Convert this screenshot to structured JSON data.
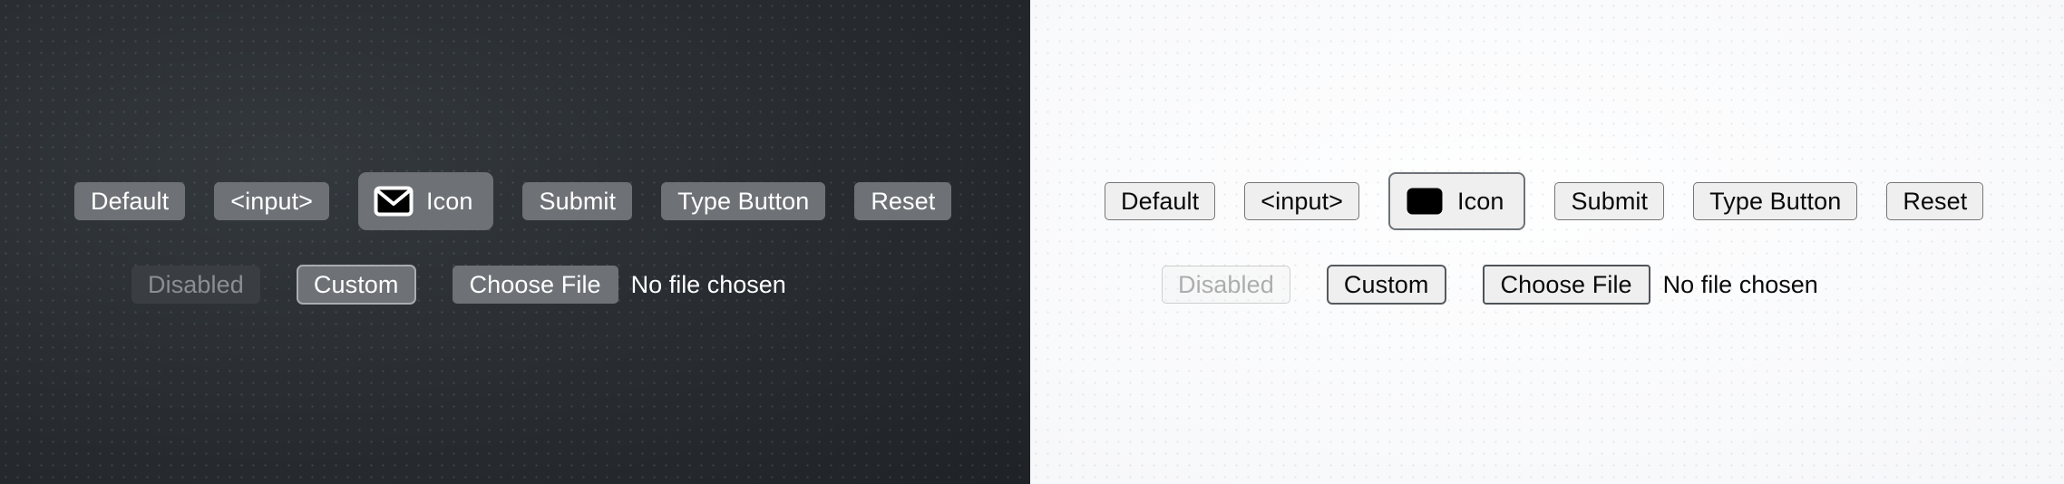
{
  "theme": {
    "dark_background": "#272b2f",
    "light_background": "#f8f9fb",
    "dark_button_fill": "#6e7176",
    "dark_button_text": "#ffffff",
    "dark_disabled_fill": "#3a3e42",
    "dark_disabled_text": "#8b8f94",
    "light_button_fill": "#efefef",
    "light_button_border": "#767676",
    "light_button_text": "#0a0a0a",
    "icon_glyph_color": "#ffffff",
    "icon_glyph_fill": "#000000"
  },
  "panels": [
    {
      "name": "dark",
      "row_primary": [
        {
          "key": "default",
          "label": "Default",
          "icon": null
        },
        {
          "key": "input",
          "label": "<input>",
          "icon": null
        },
        {
          "key": "icon",
          "label": "Icon",
          "icon": "envelope-icon"
        },
        {
          "key": "submit",
          "label": "Submit",
          "icon": null
        },
        {
          "key": "type-button",
          "label": "Type Button",
          "icon": null
        },
        {
          "key": "reset",
          "label": "Reset",
          "icon": null
        }
      ],
      "row_secondary": {
        "disabled_label": "Disabled",
        "custom_label": "Custom",
        "file_button_label": "Choose File",
        "file_status": "No file chosen"
      }
    },
    {
      "name": "light",
      "row_primary": [
        {
          "key": "default",
          "label": "Default",
          "icon": null
        },
        {
          "key": "input",
          "label": "<input>",
          "icon": null
        },
        {
          "key": "icon",
          "label": "Icon",
          "icon": "envelope-icon"
        },
        {
          "key": "submit",
          "label": "Submit",
          "icon": null
        },
        {
          "key": "type-button",
          "label": "Type Button",
          "icon": null
        },
        {
          "key": "reset",
          "label": "Reset",
          "icon": null
        }
      ],
      "row_secondary": {
        "disabled_label": "Disabled",
        "custom_label": "Custom",
        "file_button_label": "Choose File",
        "file_status": "No file chosen"
      }
    }
  ]
}
